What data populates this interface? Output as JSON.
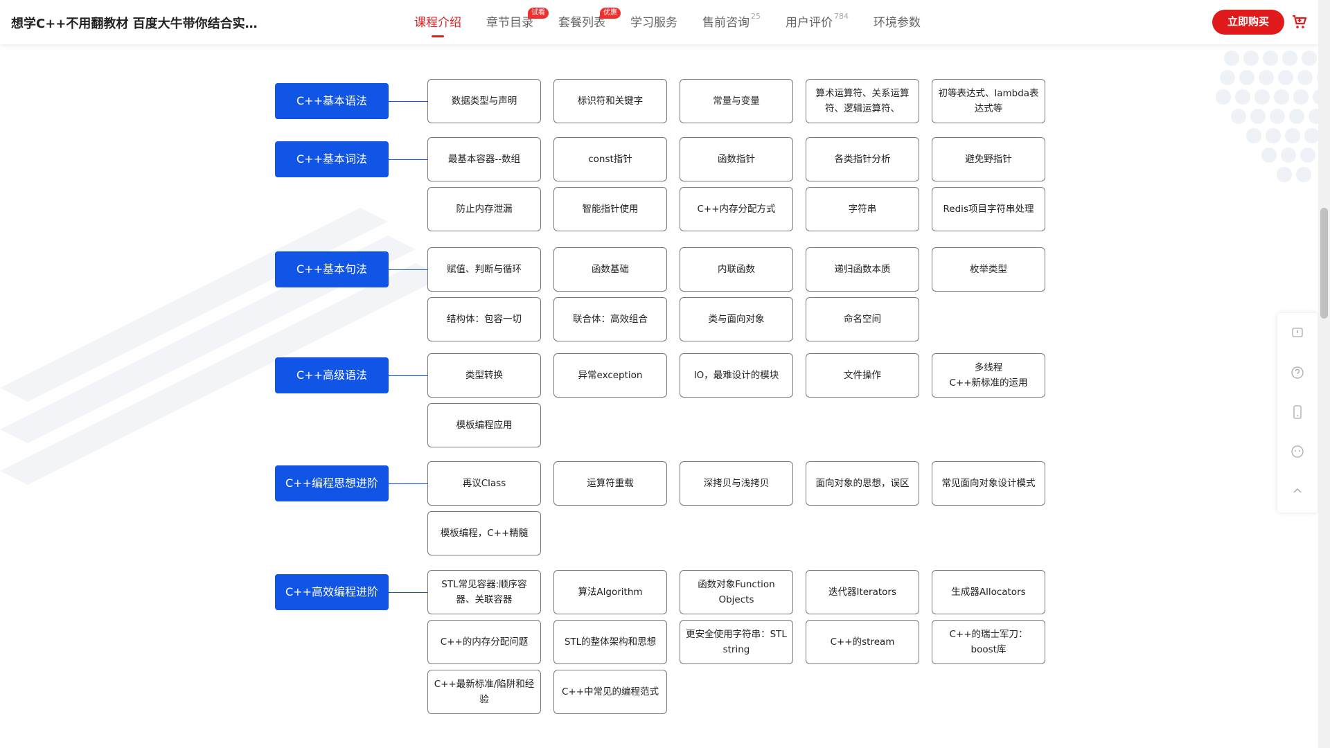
{
  "header": {
    "title": "想学C++不用翻教材 百度大牛带你结合实…",
    "tabs": [
      {
        "label": "课程介绍",
        "active": true
      },
      {
        "label": "章节目录",
        "badge": "试看"
      },
      {
        "label": "套餐列表",
        "badge": "优惠"
      },
      {
        "label": "学习服务"
      },
      {
        "label": "售前咨询",
        "count": "25"
      },
      {
        "label": "用户评价",
        "count": "784"
      },
      {
        "label": "环境参数"
      }
    ],
    "buy_label": "立即购买"
  },
  "colors": {
    "accent": "#e02020",
    "category": "#1155e6",
    "buy": "#e11b1b"
  },
  "side_tools": [
    "feedback-icon",
    "help-icon",
    "mobile-icon",
    "service-icon",
    "back-to-top-icon"
  ],
  "groups": [
    {
      "name": "C++基本语法",
      "items": [
        "数据类型与声明",
        "标识符和关键字",
        "常量与变量",
        "算术运算符、关系运算符、逻辑运算符、",
        "初等表达式、lambda表达式等"
      ]
    },
    {
      "name": "C++基本词法",
      "items": [
        "最基本容器--数组",
        "const指针",
        "函数指针",
        "各类指针分析",
        "避免野指针",
        "防止内存泄漏",
        "智能指针使用",
        "C++内存分配方式",
        "字符串",
        "Redis项目字符串处理"
      ]
    },
    {
      "name": "C++基本句法",
      "items": [
        "赋值、判断与循环",
        "函数基础",
        "内联函数",
        "递归函数本质",
        "枚举类型",
        "结构体：包容一切",
        "联合体：高效组合",
        "类与面向对象",
        "命名空间"
      ]
    },
    {
      "name": "C++高级语法",
      "items": [
        "类型转换",
        "异常exception",
        "IO，最难设计的模块",
        "文件操作",
        "多线程\nC++新标准的运用",
        "模板编程应用"
      ]
    },
    {
      "name": "C++编程思想进阶",
      "items": [
        "再议Class",
        "运算符重载",
        "深拷贝与浅拷贝",
        "面向对象的思想，误区",
        "常见面向对象设计模式",
        "模板编程，C++精髓"
      ]
    },
    {
      "name": "C++高效编程进阶",
      "items": [
        "STL常见容器:顺序容器、关联容器",
        "算法Algorithm",
        "函数对象Function Objects",
        "迭代器Iterators",
        "生成器Allocators",
        "C++的内存分配问题",
        "STL的整体架构和思想",
        "更安全使用字符串：STL string",
        "C++的stream",
        "C++的瑞士军刀：boost库",
        "C++最新标准/陷阱和经验",
        "C++中常见的编程范式"
      ]
    }
  ]
}
